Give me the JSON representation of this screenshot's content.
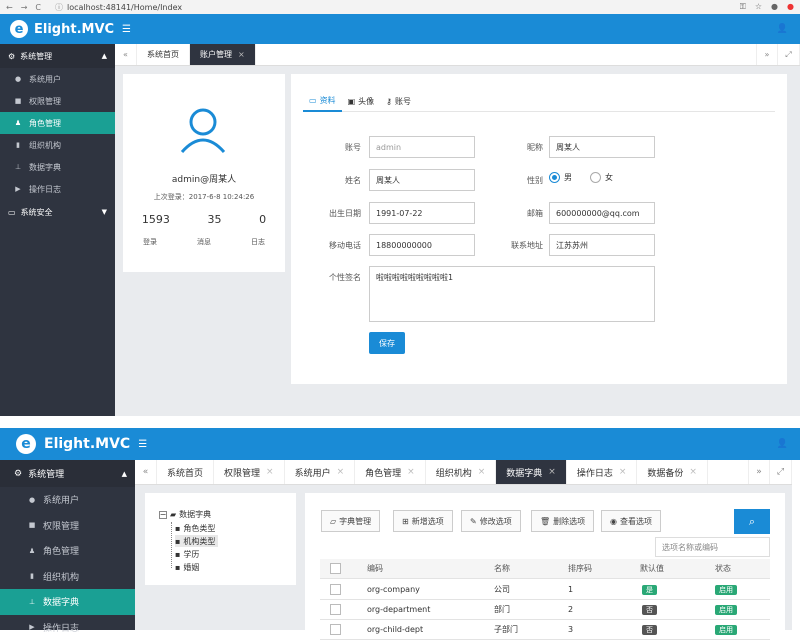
{
  "browser": {
    "url": "localhost:48141/Home/Index"
  },
  "app": {
    "title": "Elight.MVC",
    "logo_letter": "e"
  },
  "top": {
    "sidebar": {
      "group1": "系统管理",
      "items": [
        "系统用户",
        "权限管理",
        "角色管理",
        "组织机构",
        "数据字典",
        "操作日志"
      ],
      "group2": "系统安全"
    },
    "tabs": [
      "系统首页",
      "账户管理"
    ],
    "profile": {
      "username": "admin@周某人",
      "last_login": "上次登录：2017-6-8 10:24:26",
      "stats": [
        {
          "value": "1593",
          "label": "登录"
        },
        {
          "value": "35",
          "label": "消息"
        },
        {
          "value": "0",
          "label": "日志"
        }
      ]
    },
    "form_tabs": [
      "资料",
      "头像",
      "账号"
    ],
    "form": {
      "account_label": "账号",
      "account_value": "admin",
      "nickname_label": "昵称",
      "nickname_value": "周某人",
      "name_label": "姓名",
      "name_value": "周某人",
      "gender_label": "性别",
      "gender_male": "男",
      "gender_female": "女",
      "birthday_label": "出生日期",
      "birthday_value": "1991-07-22",
      "email_label": "邮箱",
      "email_value": "600000000@qq.com",
      "mobile_label": "移动电话",
      "mobile_value": "18800000000",
      "address_label": "联系地址",
      "address_value": "江苏苏州",
      "sign_label": "个性签名",
      "sign_value": "啦啦啦啦啦啦啦啦啦1",
      "save": "保存"
    }
  },
  "bottom": {
    "sidebar": {
      "group1": "系统管理",
      "items": [
        "系统用户",
        "权限管理",
        "角色管理",
        "组织机构",
        "数据字典",
        "操作日志"
      ]
    },
    "tabs": [
      "系统首页",
      "权限管理",
      "系统用户",
      "角色管理",
      "组织机构",
      "数据字典",
      "操作日志",
      "数据备份"
    ],
    "tree": {
      "root": "数据字典",
      "children": [
        "角色类型",
        "机构类型",
        "学历",
        "婚姻"
      ]
    },
    "toolbar": [
      "字典管理",
      "新增选项",
      "修改选项",
      "删除选项",
      "查看选项"
    ],
    "search_placeholder": "选项名称或编码",
    "columns": [
      "编码",
      "名称",
      "排序码",
      "默认值",
      "状态"
    ],
    "rows": [
      {
        "code": "org-company",
        "name": "公司",
        "sort": "1",
        "default": "是",
        "status": "启用"
      },
      {
        "code": "org-department",
        "name": "部门",
        "sort": "2",
        "default": "否",
        "status": "启用"
      },
      {
        "code": "org-child-dept",
        "name": "子部门",
        "sort": "3",
        "default": "否",
        "status": "启用"
      }
    ]
  },
  "colors": {
    "primary": "#1a8bd6",
    "sidebar": "#2f3440",
    "active": "#1aa094"
  }
}
